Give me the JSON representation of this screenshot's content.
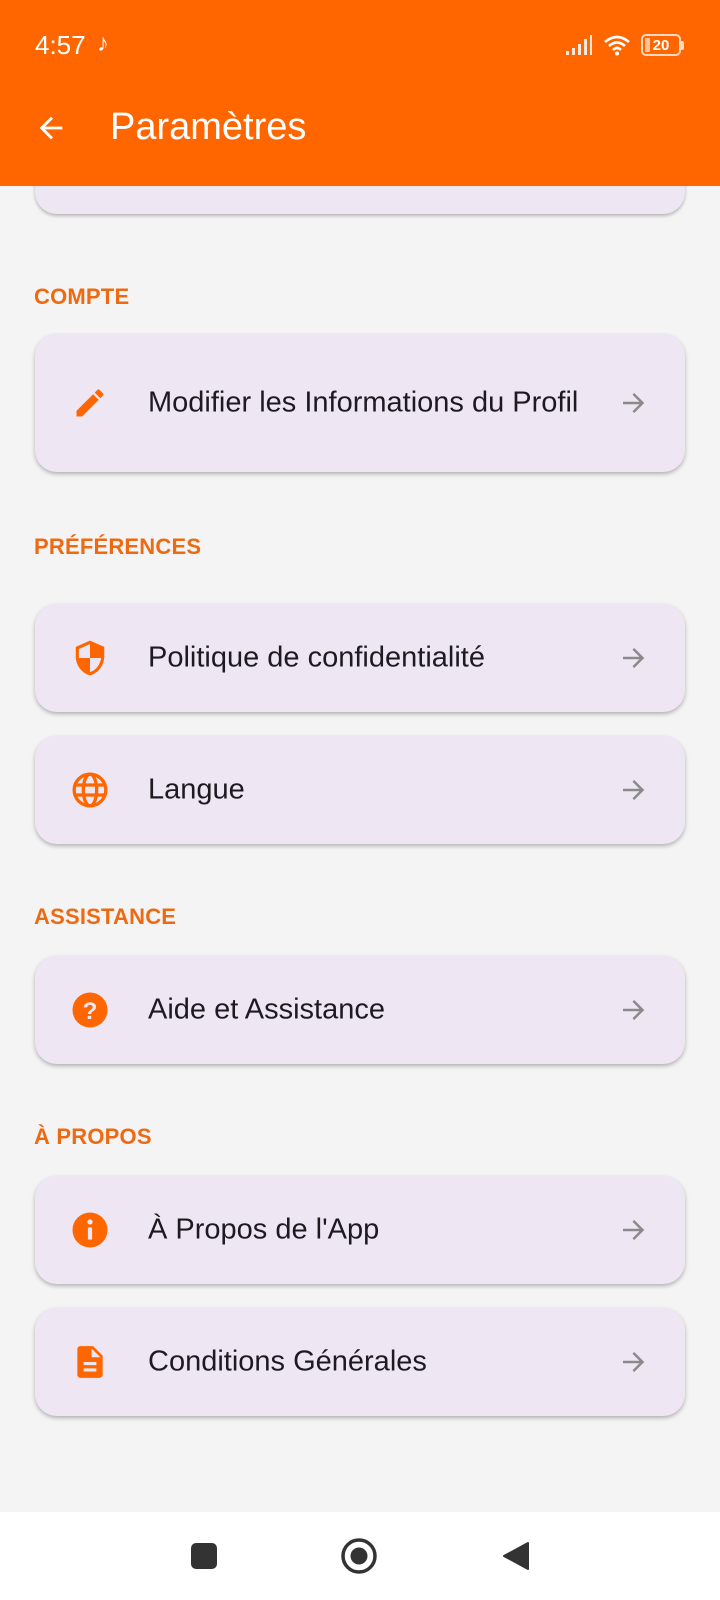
{
  "status_bar": {
    "time": "4:57",
    "music_icon": "music-note-icon",
    "battery": "20"
  },
  "header": {
    "title": "Paramètres",
    "back_icon": "arrow-left-icon"
  },
  "colors": {
    "accent": "#ff6600",
    "section": "#ee6a12",
    "card_bg": "#efe6f4",
    "page_bg": "#f4f4f4"
  },
  "sections": [
    {
      "title": "COMPTE",
      "items": [
        {
          "label": "Modifier les Informations du Profil",
          "icon": "pencil-icon"
        }
      ]
    },
    {
      "title": "PRÉFÉRENCES",
      "items": [
        {
          "label": "Politique de confidentialité",
          "icon": "shield-icon"
        },
        {
          "label": "Langue",
          "icon": "globe-icon"
        }
      ]
    },
    {
      "title": "ASSISTANCE",
      "items": [
        {
          "label": "Aide et Assistance",
          "icon": "help-circle-icon"
        }
      ]
    },
    {
      "title": "À PROPOS",
      "items": [
        {
          "label": "À Propos de l'App",
          "icon": "info-circle-icon"
        },
        {
          "label": "Conditions Générales",
          "icon": "document-icon"
        }
      ]
    }
  ],
  "nav_bar": {
    "recents_icon": "square-icon",
    "home_icon": "circle-icon",
    "back_icon": "triangle-back-icon"
  }
}
